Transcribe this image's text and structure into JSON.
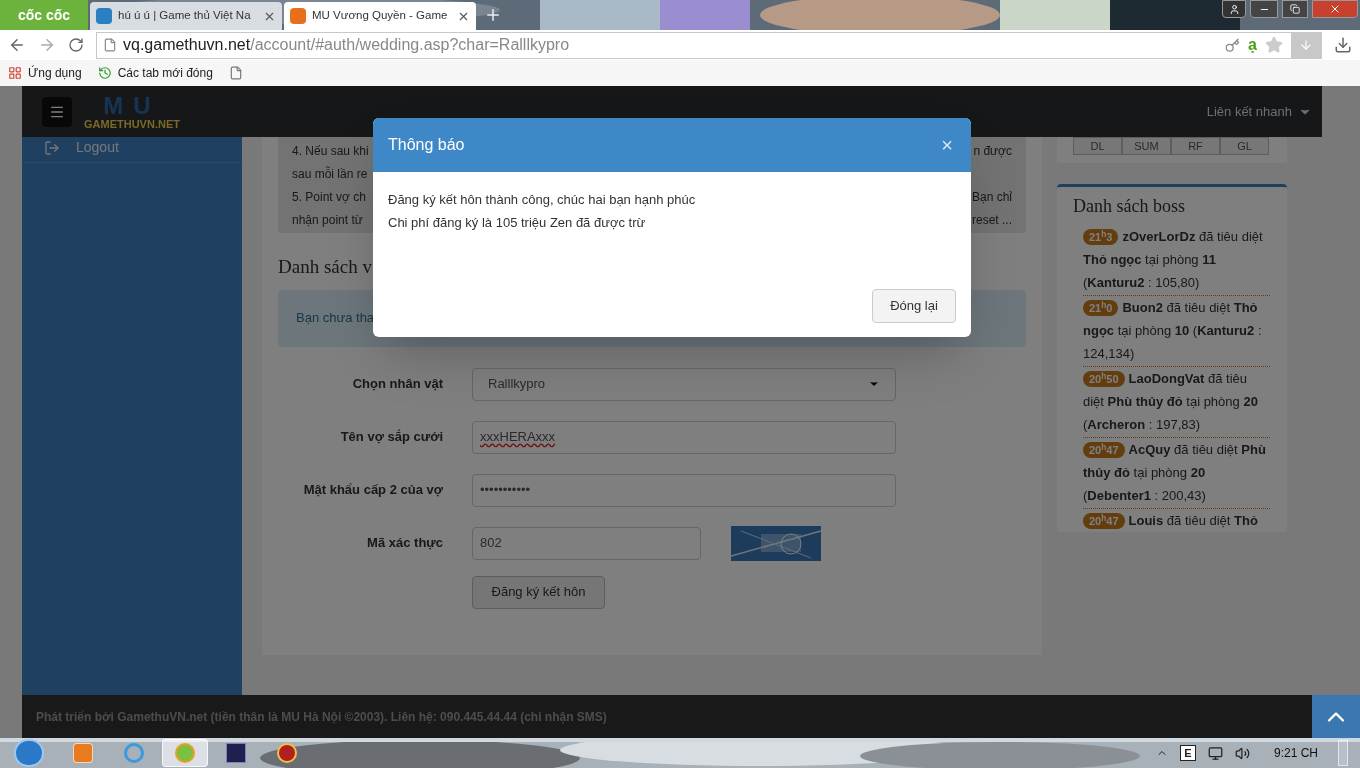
{
  "browser": {
    "logo": "cốc cốc",
    "tabs": [
      {
        "title": "hú ú ú | Game thủ Việt Na",
        "kind": "g",
        "selected": false
      },
      {
        "title": "MU Vương Quyền - Game",
        "kind": "crown",
        "selected": true
      }
    ],
    "address": {
      "host": "vq.gamethuvn.net",
      "path": "/account/#auth/wedding.asp?char=Ralllkypro"
    },
    "extension_label": "ạ",
    "bookmarks": [
      {
        "kind": "apps",
        "label": "Ứng dụng"
      },
      {
        "kind": "history",
        "label": "Các tab mới đóng"
      },
      {
        "kind": "page"
      }
    ]
  },
  "navbar": {
    "logo_backdrop": "MU",
    "logo_text": "GAMETHUVN.NET",
    "quick_links": "Liên kết nhanh"
  },
  "sidebar": {
    "items": [
      {
        "label": "Logout"
      }
    ]
  },
  "info": {
    "lines": [
      {
        "left": "4. Nếu sau khi",
        "right": "n được"
      },
      {
        "left": "sau mỗi lần re"
      },
      {
        "left": "5. Point vợ ch",
        "right": "Bạn chỉ"
      },
      {
        "left": "nhận point từ",
        "right": "reset ..."
      }
    ]
  },
  "wife_list": {
    "title": "Danh sách v",
    "notice": "Bạn chưa tha"
  },
  "form": {
    "rows": [
      {
        "kind": "select",
        "label": "Chọn nhân vật",
        "value": "Ralllkypro"
      },
      {
        "kind": "text",
        "label": "Tên vợ sắp cưới",
        "value": "xxxHERAxxx",
        "misspelled": true
      },
      {
        "kind": "password",
        "label": "Mật khẩu cấp 2 của vợ",
        "value": "•••••••••••"
      },
      {
        "kind": "captcha",
        "label": "Mã xác thực",
        "value": "802"
      }
    ],
    "submit": "Đăng ký kết hôn"
  },
  "class_buttons": [
    "DL",
    "SUM",
    "RF",
    "GL"
  ],
  "boss_list": {
    "title": "Danh sách boss",
    "entries": [
      {
        "time": "21$^{h}$3",
        "text": "**zOverLorDz** đã tiêu diệt **Thỏ ngọc** tại phòng **11** (**Kanturu2** : 105,80)"
      },
      {
        "time": "21$^{h}$0",
        "text": "**Buon2** đã tiêu diệt **Thỏ ngọc** tại phòng **10** (**Kanturu2** : 124,134)"
      },
      {
        "time": "20$^{h}$50",
        "text": "**LaoDongVat** đã tiêu diệt **Phù thủy đỏ** tại phòng **20** (**Archeron** : 197,83)"
      },
      {
        "time": "20$^{h}$47",
        "text": "**AcQuy** đã tiêu diệt **Phù thủy đỏ** tại phòng **20** (**Debenter1** : 200,43)"
      },
      {
        "time": "20$^{h}$47",
        "text": "**Louis** đã tiêu diệt **Thỏ**"
      }
    ]
  },
  "footer": "Phát triển bởi GamethuVN.net (tiền thân là MU Hà Nội ©2003). Liên hệ: 090.445.44.44 (chỉ nhận SMS)",
  "modal": {
    "title": "Thông báo",
    "close": "×",
    "lines": [
      "Đăng ký kết hôn thành công, chúc hai bạn hạnh phúc",
      "Chi phí đăng ký là 105 triệu Zen đã được trừ"
    ],
    "button": "Đóng lại"
  },
  "taskbar": {
    "apps": [
      {
        "kind": "media",
        "selected": false
      },
      {
        "kind": "ie",
        "selected": false
      },
      {
        "kind": "coccoc",
        "selected": true
      },
      {
        "kind": "game",
        "selected": false
      },
      {
        "kind": "disc",
        "selected": false
      }
    ],
    "language": "E",
    "clock": "9:21 CH"
  }
}
